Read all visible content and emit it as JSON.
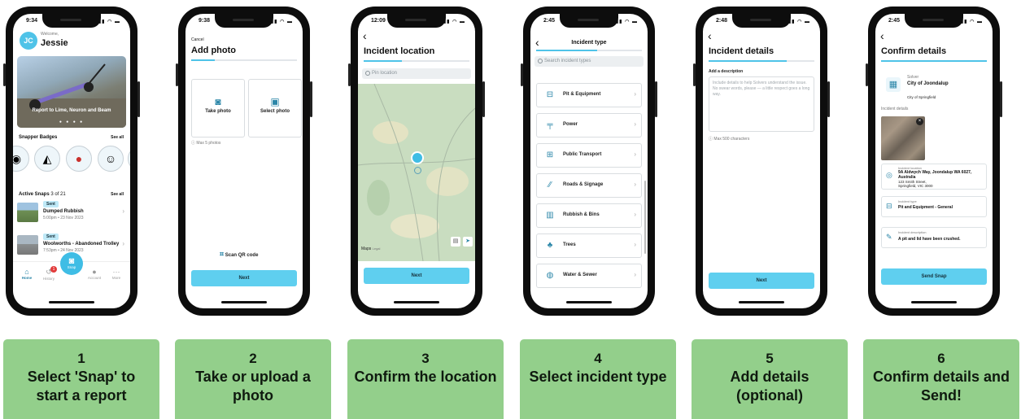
{
  "status_times": [
    "9:34",
    "9:38",
    "12:09",
    "2:45",
    "2:48",
    "2:45"
  ],
  "colors": {
    "accent": "#5fcfef",
    "caption_bg": "#93cf8b",
    "phone": "#0d0d0d"
  },
  "screen1": {
    "avatar": "JC",
    "welcome": "Welcome,",
    "name": "Jessie",
    "banner_text": "Report to Lime, Neuron and Beam",
    "badges_title": "Snapper Badges",
    "badges_see_all": "See all",
    "badge_icons": [
      "map-pin-badge-icon",
      "folded-map-badge-icon",
      "boxing-glove-badge-icon",
      "person-badge-icon",
      "scooter-badge-icon"
    ],
    "active_title": "Active Snaps",
    "active_count": "3 of 21",
    "active_see_all": "See all",
    "snaps": [
      {
        "status": "Sent",
        "title": "Dumped Rubbish",
        "time": "5:00pm • 23 Nov 2023"
      },
      {
        "status": "Sent",
        "title": "Woolworths - Abandoned Trolley",
        "time": "7:53pm • 24 Nov 2023"
      }
    ],
    "nav": [
      {
        "label": "Home",
        "icon": "home-icon"
      },
      {
        "label": "History",
        "icon": "history-icon",
        "badge": "1"
      },
      {
        "label": "Snap",
        "icon": "camera-icon"
      },
      {
        "label": "Account",
        "icon": "account-icon"
      },
      {
        "label": "More",
        "icon": "more-icon"
      }
    ]
  },
  "screen2": {
    "cancel": "Cancel",
    "title": "Add photo",
    "take_photo": "Take photo",
    "select_photo": "Select photo",
    "max_note": "Max 5 photos",
    "scan_qr": "Scan QR code",
    "next": "Next"
  },
  "screen3": {
    "title": "Incident location",
    "search_placeholder": "Pin location",
    "maps_label": "Maps",
    "legal": "Legal",
    "next": "Next"
  },
  "screen4": {
    "title": "Incident type",
    "search_placeholder": "Search incident types",
    "types": [
      {
        "label": "Pit & Equipment",
        "icon": "pit-icon"
      },
      {
        "label": "Power",
        "icon": "power-pole-icon"
      },
      {
        "label": "Public Transport",
        "icon": "bus-icon"
      },
      {
        "label": "Roads & Signage",
        "icon": "road-icon"
      },
      {
        "label": "Rubbish & Bins",
        "icon": "bin-icon"
      },
      {
        "label": "Trees",
        "icon": "tree-icon"
      },
      {
        "label": "Water & Sewer",
        "icon": "water-drop-icon"
      }
    ]
  },
  "screen5": {
    "title": "Incident details",
    "add_description": "Add a description",
    "placeholder": "Include details to help Solvers understand the issue. No swear words, please — a little respect goes a long way.",
    "max_chars": "Max 500 characters",
    "next": "Next"
  },
  "screen6": {
    "title": "Confirm details",
    "solver_label": "Solver",
    "solver_name": "City of Joondalup",
    "solver_overlay": "City of Springfield",
    "incident_details": "Incident details",
    "location_label": "Incident location",
    "location_value": "9A Aldwych Way, Joondalup WA 6027, Australia",
    "location_overlay": "123 Smith Street, Springfield, VIC 3000",
    "type_label": "Incident type",
    "type_value": "Pit and Equipment - General",
    "desc_label": "Incident description",
    "desc_value": "A pit and lid have been crushed.",
    "send": "Send Snap"
  },
  "captions": [
    {
      "num": "1",
      "text": "Select 'Snap' to start a report"
    },
    {
      "num": "2",
      "text": "Take or upload a photo"
    },
    {
      "num": "3",
      "text": "Confirm the location"
    },
    {
      "num": "4",
      "text": "Select incident type"
    },
    {
      "num": "5",
      "text": "Add details (optional)"
    },
    {
      "num": "6",
      "text": "Confirm details and Send!"
    }
  ]
}
